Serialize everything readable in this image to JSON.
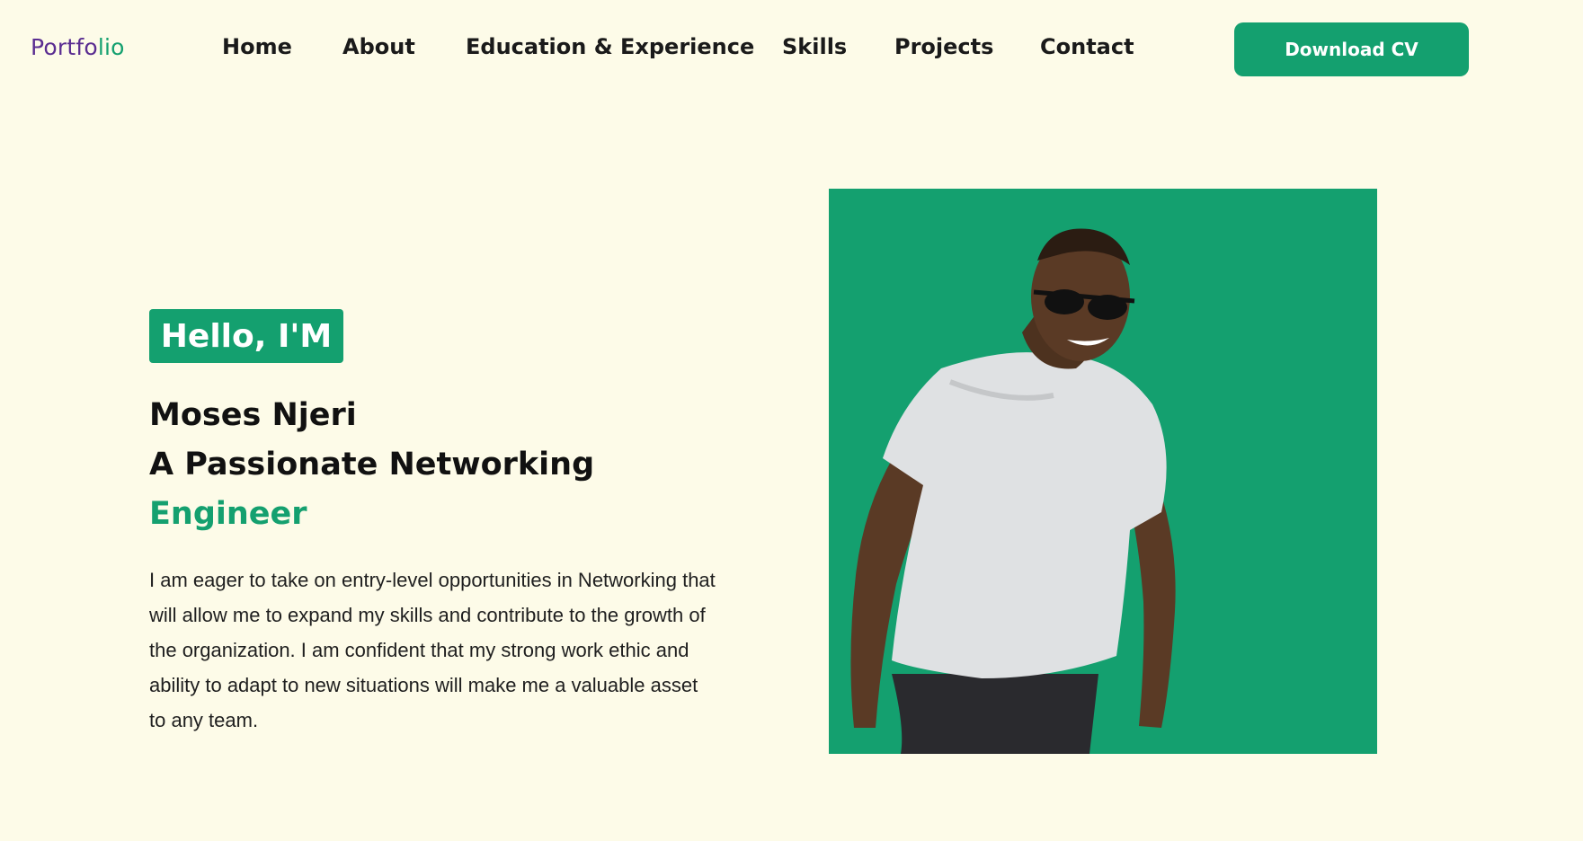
{
  "logo": {
    "part1": "Portfo",
    "part2": "lio"
  },
  "nav": {
    "items": [
      "Home",
      "About",
      "Education & Experience",
      "Skills",
      "Projects",
      "Contact"
    ],
    "cta_label": "Download CV"
  },
  "hero": {
    "greeting": "Hello, I'M",
    "name": "Moses Njeri",
    "tagline": "A Passionate Networking",
    "role": "Engineer",
    "bio": "I am eager to take on entry-level opportunities in Networking that will allow me to expand my skills and contribute to the growth of the organization. I am confident that my strong work ethic and ability to adapt to new situations will make me a valuable asset to any team."
  },
  "colors": {
    "background": "#fdfbe8",
    "accent": "#14a06f",
    "logo_purple": "#5a2d91"
  }
}
